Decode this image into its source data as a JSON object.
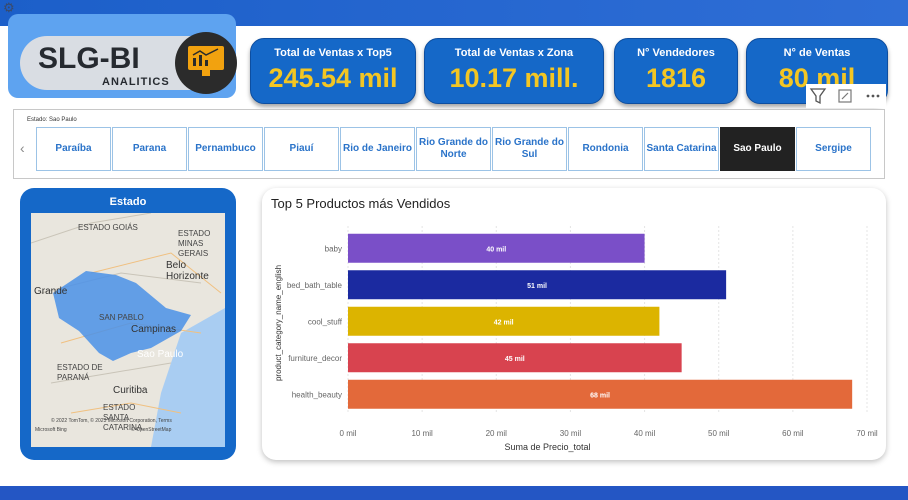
{
  "header": {
    "brand_main": "SLG-BI",
    "brand_sub": "ANALITICS"
  },
  "kpis": [
    {
      "label": "Total de Ventas x Top5",
      "value": "245.54 mil"
    },
    {
      "label": "Total de Ventas x Zona",
      "value": "10.17 mill."
    },
    {
      "label": "N° Vendedores",
      "value": "1816"
    },
    {
      "label": "N° de Ventas",
      "value": "80 mil"
    }
  ],
  "slicer": {
    "title": "Estado: Sao Paulo",
    "items": [
      "Paraíba",
      "Parana",
      "Pernambuco",
      "Piauí",
      "Rio de Janeiro",
      "Rio Grande do Norte",
      "Rio Grande do Sul",
      "Rondonia",
      "Santa Catarina",
      "Sao Paulo",
      "Sergipe"
    ],
    "selected": "Sao Paulo"
  },
  "map": {
    "title": "Estado",
    "labels": [
      "ESTADO GOIÁS",
      "ESTADO MINAS GERAIS",
      "Belo Horizonte",
      "Grande",
      "SAN PABLO",
      "Campinas",
      "Sao Paulo",
      "ESTADO DE PARANÁ",
      "Curitiba",
      "ESTADO SANTA CATARINA"
    ],
    "credit": "© 2022 TomTom, © 2023 Microsoft Corporation, Terms",
    "credit2": "© OpenStreetMap",
    "bing": "Microsoft Bing",
    "highlight_color": "#4a90e8"
  },
  "chart_data": {
    "type": "bar",
    "orientation": "horizontal",
    "title": "Top 5 Productos más Vendidos",
    "xlabel": "Suma de Precio_total",
    "ylabel": "product_category_name_english",
    "categories": [
      "baby",
      "bed_bath_table",
      "cool_stuff",
      "furniture_decor",
      "health_beauty"
    ],
    "values": [
      40,
      51,
      42,
      45,
      68
    ],
    "data_labels": [
      "40 mil",
      "51 mil",
      "42 mil",
      "45 mil",
      "68 mil"
    ],
    "colors": [
      "#7a4fc8",
      "#1b2aa0",
      "#dcb400",
      "#d8434f",
      "#e3693a"
    ],
    "xlim": [
      0,
      70
    ],
    "xticks": [
      "0 mil",
      "10 mil",
      "20 mil",
      "30 mil",
      "40 mil",
      "50 mil",
      "60 mil",
      "70 mil"
    ]
  }
}
